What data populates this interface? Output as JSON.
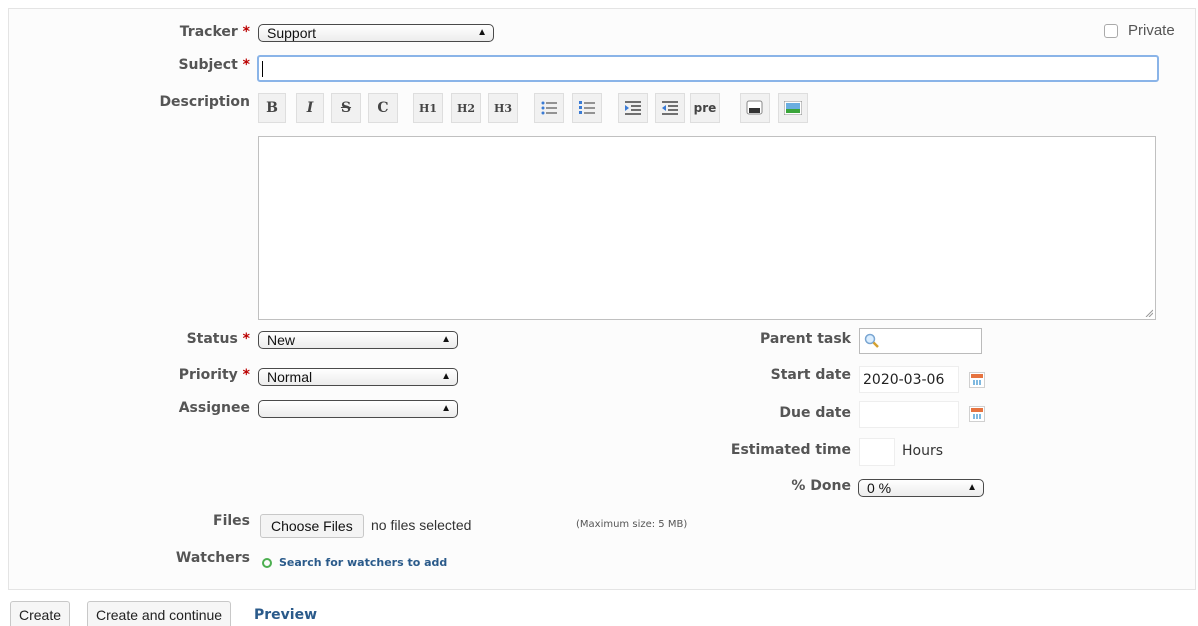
{
  "form": {
    "tracker": {
      "label": "Tracker",
      "required": "*",
      "value": "Support"
    },
    "private_label": "Private",
    "subject": {
      "label": "Subject",
      "required": "*",
      "value": ""
    },
    "description": {
      "label": "Description",
      "value": ""
    },
    "toolbar": {
      "bold": "B",
      "italic": "I",
      "strike": "S",
      "code": "C",
      "h1": "H1",
      "h2": "H2",
      "h3": "H3",
      "pre": "pre"
    },
    "status": {
      "label": "Status",
      "required": "*",
      "value": "New"
    },
    "priority": {
      "label": "Priority",
      "required": "*",
      "value": "Normal"
    },
    "assignee": {
      "label": "Assignee",
      "value": ""
    },
    "parent_task": {
      "label": "Parent task",
      "value": ""
    },
    "start_date": {
      "label": "Start date",
      "value": "2020-03-06"
    },
    "due_date": {
      "label": "Due date",
      "value": ""
    },
    "estimated_time": {
      "label": "Estimated time",
      "value": "",
      "unit": "Hours"
    },
    "done": {
      "label": "% Done",
      "value": "0 %"
    },
    "files": {
      "label": "Files",
      "button": "Choose Files",
      "status": "no files selected",
      "max_size": "(Maximum size: 5 MB)"
    },
    "watchers": {
      "label": "Watchers",
      "link": "Search for watchers to add"
    }
  },
  "actions": {
    "create": "Create",
    "create_continue": "Create and continue",
    "preview": "Preview"
  },
  "colors": {
    "required": "#bb0000",
    "link": "#2a5a8a",
    "focus": "#5b9bd5",
    "watchers_icon": "#4caf50"
  }
}
